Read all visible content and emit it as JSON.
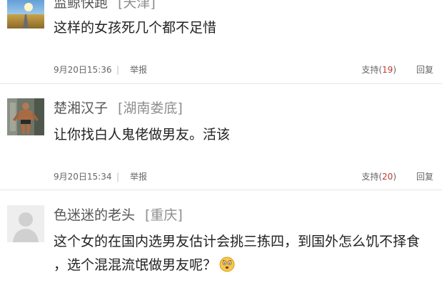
{
  "comments": [
    {
      "username": "监鲸快跑",
      "location": "[天津]",
      "body": "这样的女孩死几个都不足惜",
      "time": "9月20日15:36",
      "separator": "|",
      "report_label": "举报",
      "support_label": "支持(",
      "support_count": "19",
      "support_close": ")",
      "reply_label": "回复"
    },
    {
      "username": "楚湘汉子",
      "location": "[湖南娄底]",
      "body": "让你找白人鬼佬做男友。活该",
      "time": "9月20日15:34",
      "separator": "|",
      "report_label": "举报",
      "support_label": "支持(",
      "support_count": "20",
      "support_close": ")",
      "reply_label": "回复"
    },
    {
      "username": "色迷迷的老头",
      "location": "[重庆]",
      "body_line1": "这个女的在国内选男友估计会挑三拣四，到国外怎么饥不择食",
      "body_line2": "，选个混混流氓做男友呢？"
    }
  ],
  "colors": {
    "support_count": "#c0392b",
    "divider": "#e6e6e6"
  },
  "icons": {
    "emoji": "shocked-face-emoji"
  }
}
